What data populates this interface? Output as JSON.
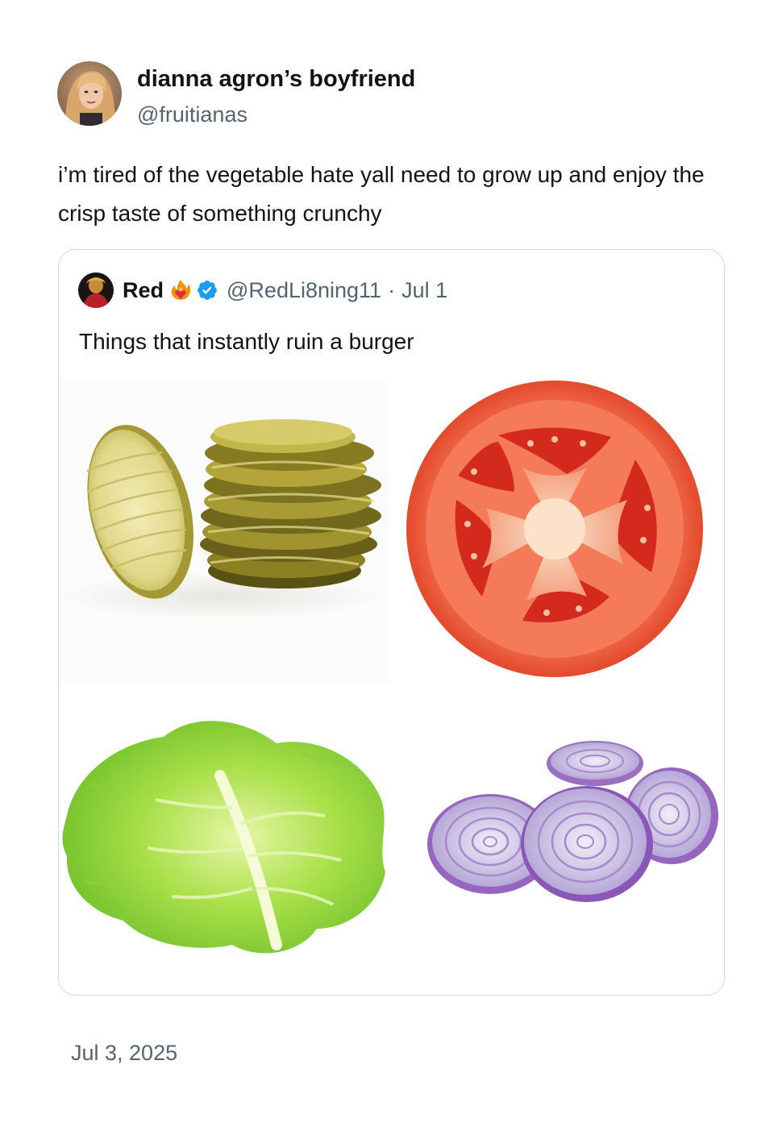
{
  "author": {
    "display_name": "dianna agron’s boyfriend",
    "handle": "@fruitianas"
  },
  "tweet": {
    "text": "i’m tired of the vegetable hate yall need to grow up and enjoy the crisp taste of something crunchy",
    "timestamp": "Jul 3, 2025"
  },
  "quoted_tweet": {
    "display_name": "Red",
    "name_emoji": "fire-heart-icon",
    "verified_icon": "verified-badge-icon",
    "handle": "@RedLi8ning11",
    "separator": "·",
    "date": "Jul 1",
    "text": "Things that instantly ruin a burger",
    "media": [
      {
        "subject": "pickle-slices"
      },
      {
        "subject": "tomato-slice"
      },
      {
        "subject": "lettuce-leaf"
      },
      {
        "subject": "red-onion-slices"
      }
    ]
  },
  "colors": {
    "text_primary": "#0f1419",
    "text_secondary": "#536471",
    "border": "#cfd9de",
    "verified": "#1d9bf0"
  }
}
